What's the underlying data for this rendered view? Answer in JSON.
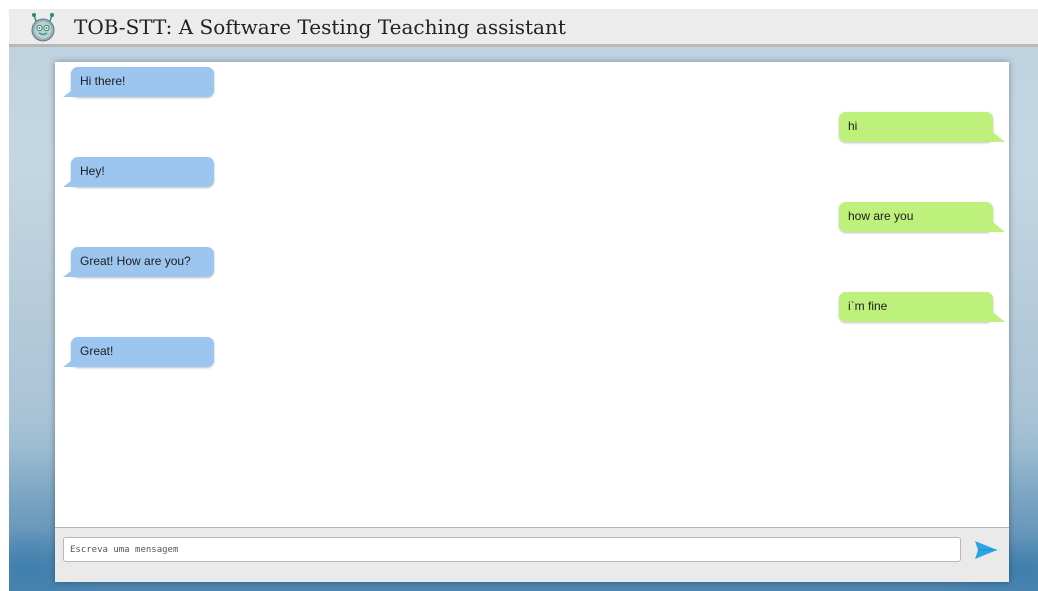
{
  "header": {
    "title": "TOB-STT: A Software Testing Teaching assistant",
    "logo_icon": "robot-head-icon"
  },
  "messages": [
    {
      "sender": "bot",
      "text": "Hi there!"
    },
    {
      "sender": "user",
      "text": "hi"
    },
    {
      "sender": "bot",
      "text": "Hey!"
    },
    {
      "sender": "user",
      "text": "how are you"
    },
    {
      "sender": "bot",
      "text": "Great! How are you?"
    },
    {
      "sender": "user",
      "text": "i`m fine"
    },
    {
      "sender": "bot",
      "text": "Great!"
    }
  ],
  "composer": {
    "placeholder": "Escreva uma mensagem",
    "value": "",
    "send_icon": "send-arrow-icon"
  },
  "colors": {
    "bot_bubble": "#9cc5ef",
    "user_bubble": "#bef07c",
    "send_accent": "#2aa6e8",
    "header_bg": "#ececec"
  }
}
